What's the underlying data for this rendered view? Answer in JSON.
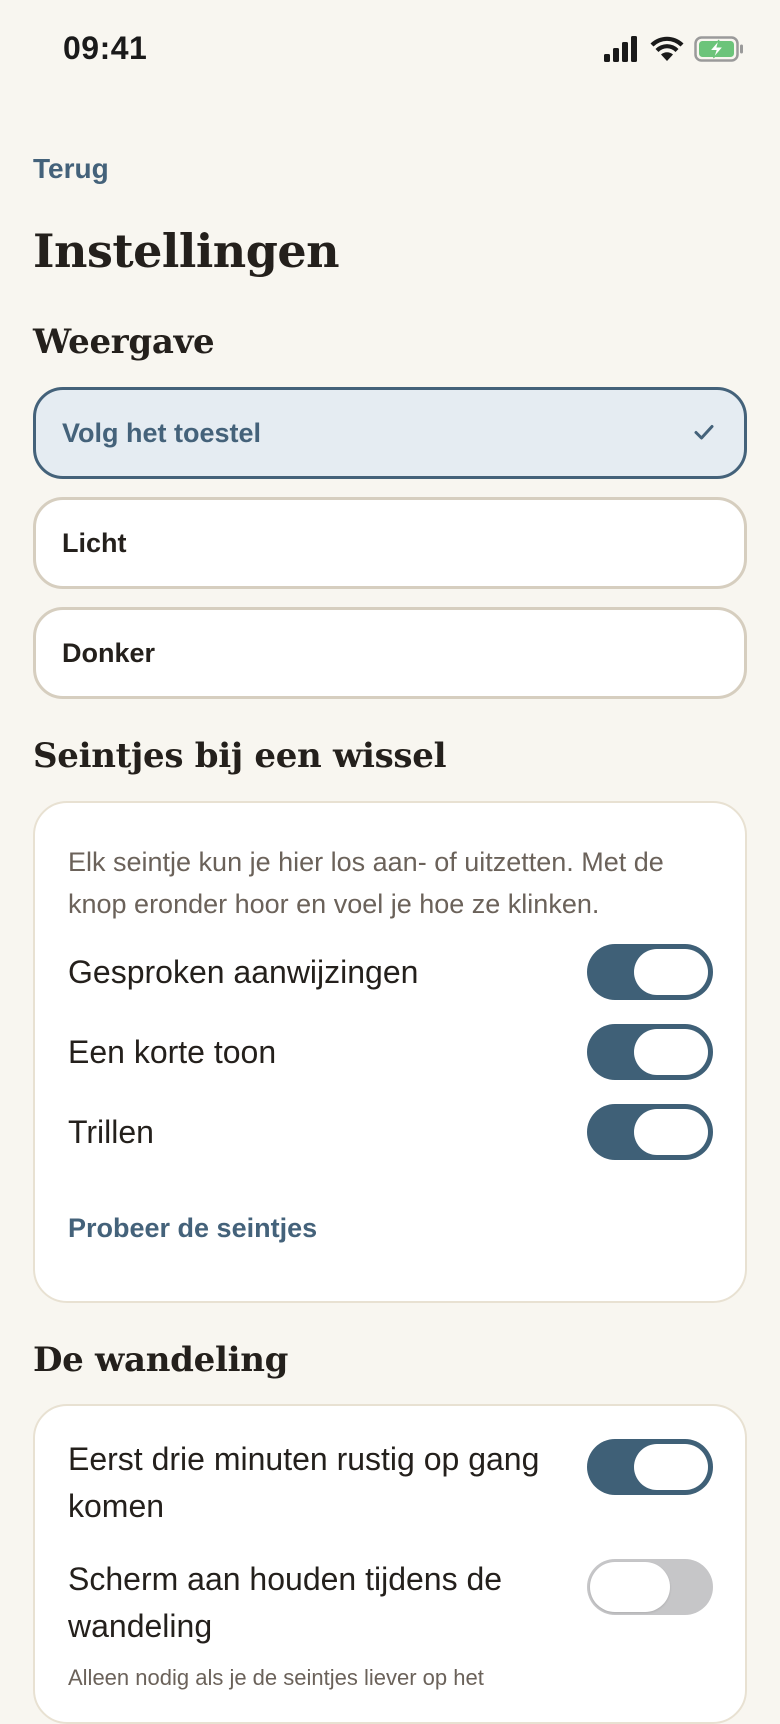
{
  "status_bar": {
    "time": "09:41",
    "icons": [
      "signal-icon",
      "wifi-icon",
      "battery-charging-icon"
    ],
    "battery_color": "#6cc47a"
  },
  "nav": {
    "back_label": "Terug"
  },
  "page": {
    "title": "Instellingen"
  },
  "appearance": {
    "title": "Weergave",
    "options": [
      {
        "label": "Volg het toestel",
        "selected": true
      },
      {
        "label": "Licht",
        "selected": false
      },
      {
        "label": "Donker",
        "selected": false
      }
    ]
  },
  "signals": {
    "title": "Seintjes bij een wissel",
    "description": "Elk seintje kun je hier los aan- of uitzetten. Met de knop eronder hoor en voel je hoe ze klinken.",
    "toggles": [
      {
        "label": "Gesproken aanwijzingen",
        "on": true
      },
      {
        "label": "Een korte toon",
        "on": true
      },
      {
        "label": "Trillen",
        "on": true
      }
    ],
    "try_label": "Probeer de seintjes"
  },
  "walk": {
    "title": "De wandeling",
    "toggles": [
      {
        "label": "Eerst drie minuten rustig op gang komen",
        "on": true
      },
      {
        "label": "Scherm aan houden tijdens de wandeling",
        "on": false,
        "note": "Alleen nodig als je de seintjes liever op het"
      }
    ]
  },
  "colors": {
    "accent": "#44627a",
    "toggle_on": "#3f6077",
    "toggle_off": "#c6c6c8",
    "background": "#f8f6f0"
  }
}
